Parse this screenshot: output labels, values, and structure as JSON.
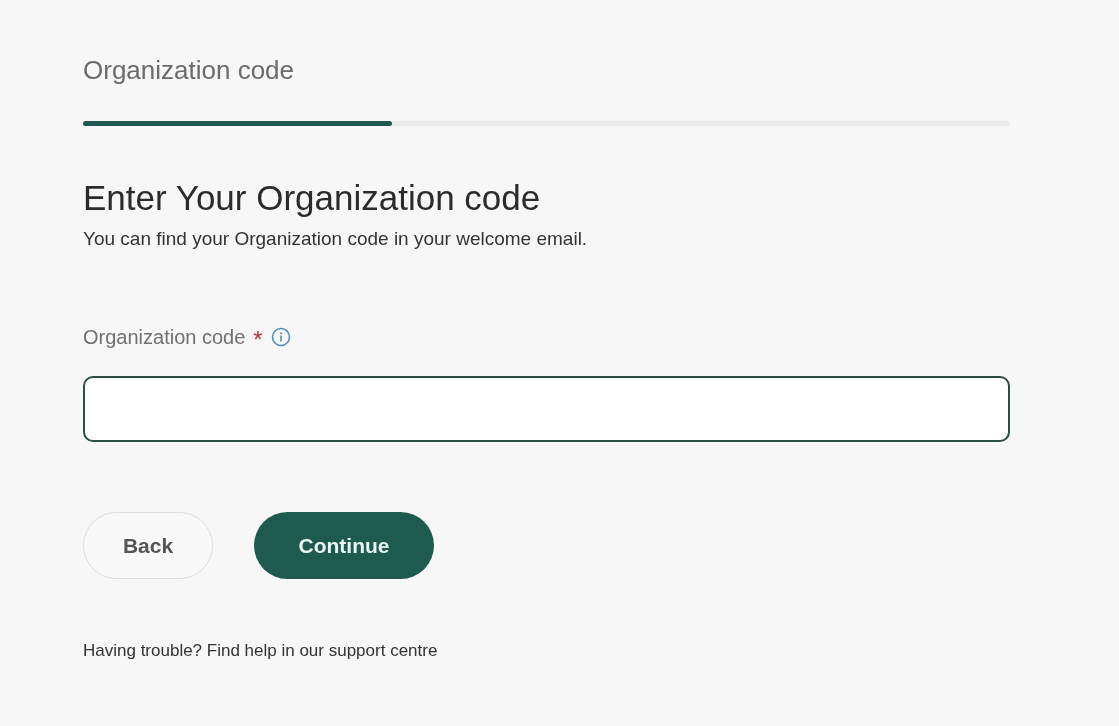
{
  "step": {
    "title": "Organization code",
    "level": 0.333
  },
  "heading": "Enter Your Organization code",
  "subtitle": "You can find your Organization code in your welcome email.",
  "field": {
    "label": "Organization code",
    "required_mark": "*",
    "info": true
  },
  "buttons": [
    {
      "label": "Back",
      "kind": "secondary"
    },
    {
      "label": "Continue",
      "kind": "primary"
    }
  ],
  "help_text": "Having trouble? Find help in our support centre"
}
